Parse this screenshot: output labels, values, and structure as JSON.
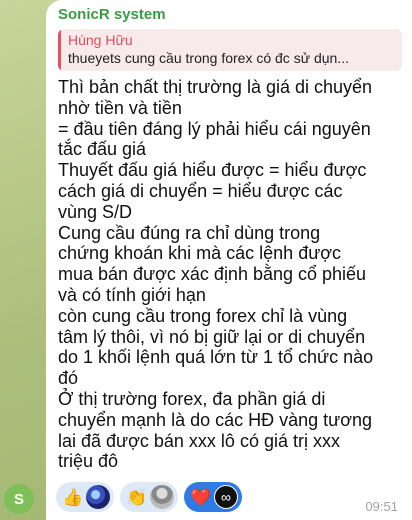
{
  "chat": {
    "sender": "SonicR system",
    "avatar_letter": "S",
    "reply": {
      "name": "Hùng Hữu",
      "text": "thueyets cung cầu trong forex có đc sử dụn..."
    },
    "message_lines": [
      "Thì bản chất thị trường là giá di chuyển",
      "nhờ tiền và tiền",
      "= đầu tiên đáng lý phải hiểu cái nguyên",
      "tắc đấu giá",
      "Thuyết đấu giá hiểu được = hiểu được",
      "cách giá di chuyển = hiểu được các",
      "vùng S/D",
      "Cung cầu đúng ra chỉ dùng trong",
      "chứng khoán khi mà các lệnh được",
      "mua bán được xác định bằng cổ phiếu",
      "và có tính giới hạn",
      "còn cung cầu trong forex chỉ là vùng",
      "tâm lý thôi, vì nó bị giữ lại or di chuyển",
      "do 1 khối lệnh quá lớn từ 1 tổ chức nào",
      "đó",
      "Ở thị trường forex, đa phần giá di",
      "chuyển mạnh là do các HĐ vàng tương",
      "lai đã được bán xxx lô có giá trị xxx",
      "triệu đô"
    ],
    "time": "09:51",
    "reactions": [
      {
        "emoji": "👍",
        "icon": "thumbs-up-icon",
        "selected": false
      },
      {
        "emoji": "👏",
        "icon": "clapping-hands-icon",
        "selected": false
      },
      {
        "emoji": "❤️",
        "icon": "red-heart-icon",
        "selected": true
      }
    ],
    "colors": {
      "sender": "#3a9a45",
      "reply_name": "#d94e5c",
      "reply_bar": "#e25260",
      "reaction_selected": "#2f7be6"
    }
  }
}
